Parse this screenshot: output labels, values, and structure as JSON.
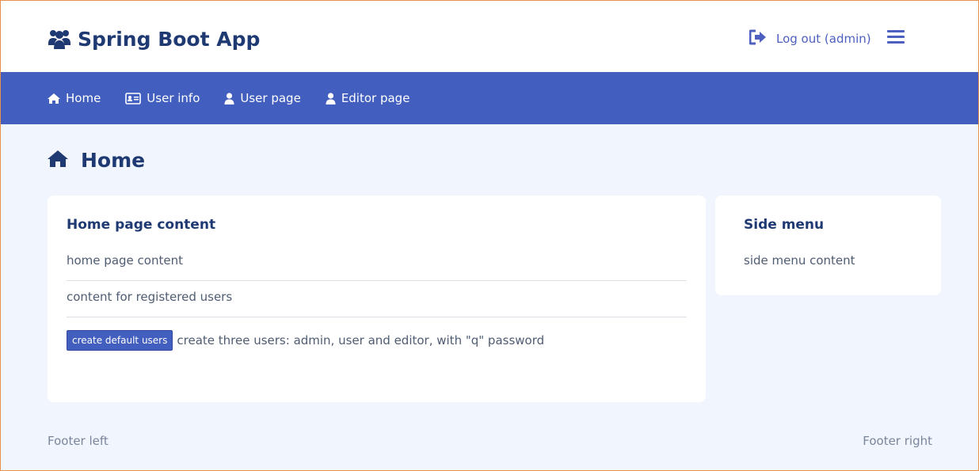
{
  "header": {
    "brand_title": "Spring Boot App",
    "logout_label": "Log out (admin)"
  },
  "nav": {
    "items": [
      {
        "label": "Home",
        "icon": "home-icon"
      },
      {
        "label": "User info",
        "icon": "id-card-icon"
      },
      {
        "label": "User page",
        "icon": "user-icon"
      },
      {
        "label": "Editor page",
        "icon": "user-icon"
      }
    ]
  },
  "page": {
    "title": "Home"
  },
  "main_card": {
    "title": "Home page content",
    "rows": [
      "home page content",
      "content for registered users"
    ],
    "button_label": "create default users",
    "button_description": "create three users: admin, user and editor, with \"q\" password"
  },
  "side_card": {
    "title": "Side menu",
    "content": "side menu content"
  },
  "footer": {
    "left": "Footer left",
    "right": "Footer right"
  },
  "colors": {
    "accent": "#425ebf",
    "title": "#1f3a73",
    "background": "#f1f5fd"
  }
}
